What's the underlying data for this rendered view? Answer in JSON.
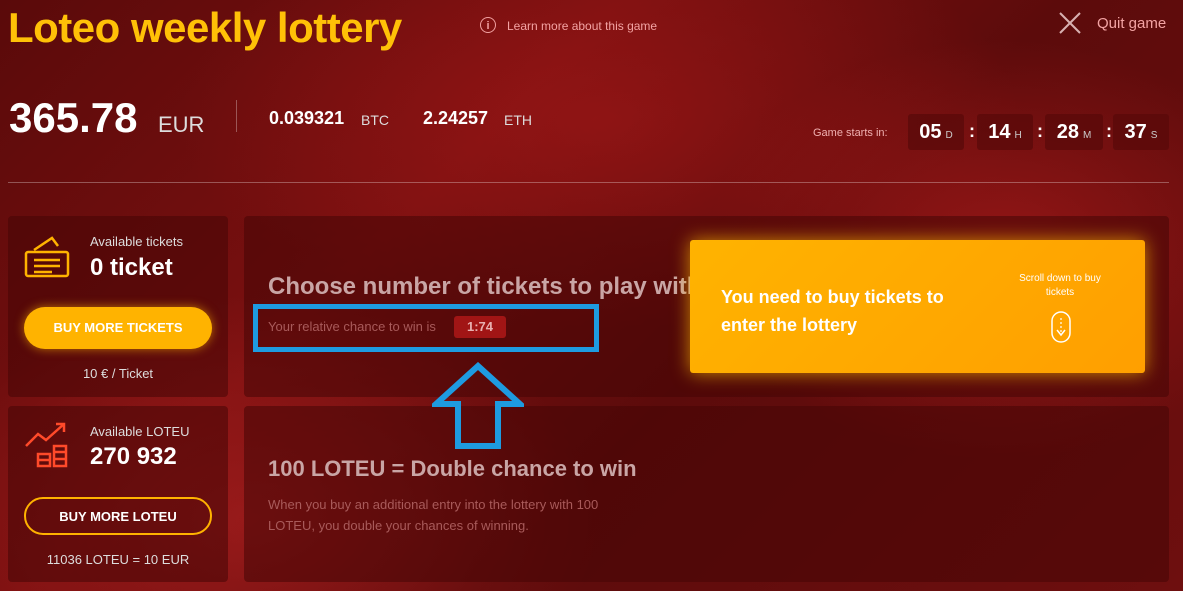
{
  "header": {
    "title": "Loteo weekly lottery",
    "learn_more": "Learn more about this game",
    "quit": "Quit game"
  },
  "balances": {
    "eur_amount": "365.78",
    "eur_unit": "EUR",
    "btc_amount": "0.039321",
    "btc_unit": "BTC",
    "eth_amount": "2.24257",
    "eth_unit": "ETH"
  },
  "countdown": {
    "label": "Game starts in:",
    "days": "05",
    "days_unit": "D",
    "hours": "14",
    "hours_unit": "H",
    "minutes": "28",
    "minutes_unit": "M",
    "seconds": "37",
    "seconds_unit": "S",
    "separator": ":"
  },
  "tickets_panel": {
    "label": "Available tickets",
    "value": "0 ticket",
    "button": "BUY MORE TICKETS",
    "price": "10 € / Ticket"
  },
  "loteu_panel": {
    "label": "Available LOTEU",
    "value": "270 932",
    "button": "BUY MORE LOTEU",
    "rate": "11036 LOTEU = 10 EUR"
  },
  "choose": {
    "title": "Choose number of tickets to play with:",
    "chance_label": "Your relative chance to win is",
    "chance_value": "1:74"
  },
  "cta": {
    "text": "You need to buy tickets to enter the lottery",
    "scroll_hint": "Scroll down to buy tickets"
  },
  "double_chance": {
    "title": "100 LOTEU = Double chance to win",
    "description": "When you buy an additional entry into the lottery with 100 LOTEU, you double your chances of winning."
  },
  "colors": {
    "accent": "#ffc107",
    "button": "#ffb300",
    "highlight": "#1e9be0",
    "badge": "#a11515"
  }
}
